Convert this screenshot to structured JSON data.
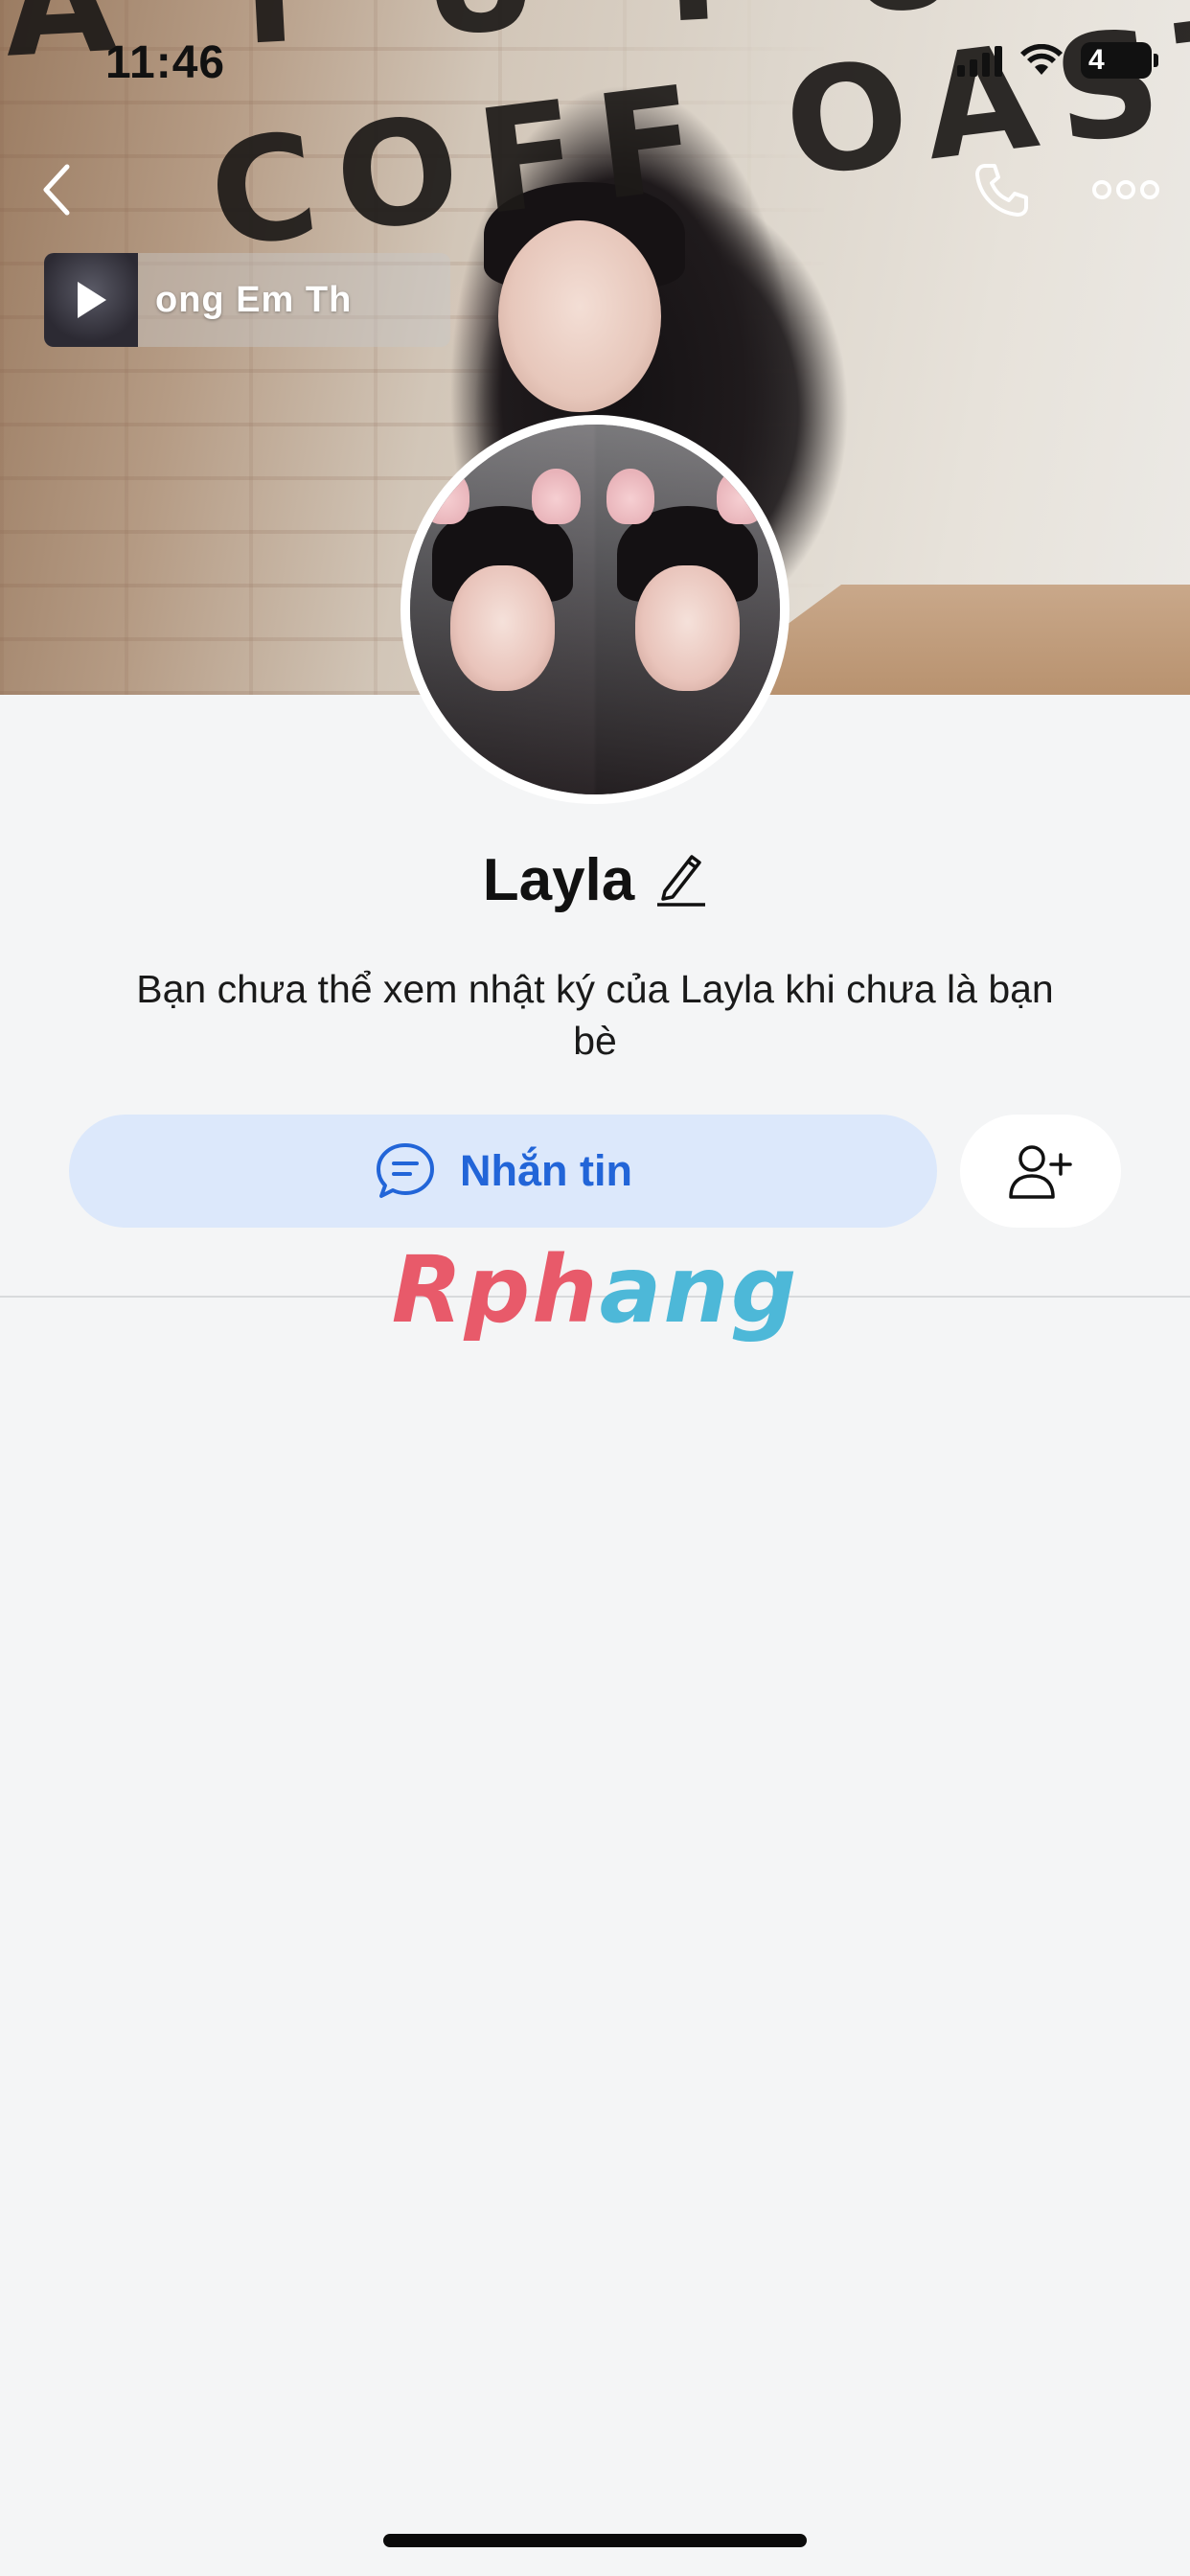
{
  "status_bar": {
    "time": "11:46",
    "battery_level": "4"
  },
  "cover": {
    "sign_text": "COFF    OASTER",
    "sign_top_text": "A  I  U I  U"
  },
  "music": {
    "title": "ong Em       Th"
  },
  "profile": {
    "name": "Layla",
    "description": "Bạn chưa thể xem nhật ký của Layla khi chưa là bạn bè"
  },
  "actions": {
    "message_label": "Nhắn tin"
  },
  "watermark": {
    "part1": "Rph",
    "part2": "ang"
  },
  "icons": {
    "back": "chevron-left-icon",
    "call": "phone-icon",
    "more": "more-horizontal-icon",
    "play": "play-icon",
    "edit": "pencil-icon",
    "message": "chat-bubble-icon",
    "add_friend": "user-plus-icon"
  },
  "colors": {
    "background": "#f4f5f6",
    "accent": "#2265d8",
    "message_button_bg": "#dce8fb"
  }
}
